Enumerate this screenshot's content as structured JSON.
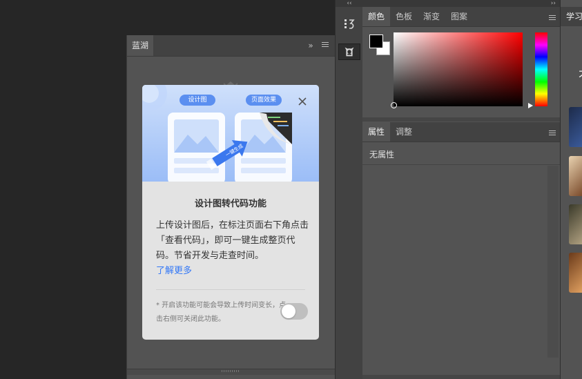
{
  "lanhu_panel": {
    "tab_label": "蓝湖"
  },
  "feature_card": {
    "badge_design": "设计图",
    "badge_effect": "页面效果",
    "arrow_label": "一键生成",
    "title": "设计图转代码功能",
    "description": "上传设计图后，在标注页面右下角点击「查看代码」，即可一键生成整页代码。节省开发与走查时间。",
    "learn_more": "了解更多",
    "note": "* 开启该功能可能会导致上传时间变长，点击右侧可关闭此功能。",
    "toggle_on": false
  },
  "color_panel": {
    "tabs": [
      "颜色",
      "色板",
      "渐变",
      "图案"
    ],
    "active_tab": "颜色",
    "foreground": "#000000",
    "background": "#ffffff"
  },
  "properties_panel": {
    "tabs": [
      "属性",
      "调整"
    ],
    "active_tab": "属性",
    "empty_text": "无属性"
  },
  "learn_panel": {
    "tab_label": "学习",
    "partial_text": "不"
  },
  "colors": {
    "accent_link": "#3478f6",
    "card_bg": "#e3e3e3",
    "panel_bg": "#535353"
  }
}
